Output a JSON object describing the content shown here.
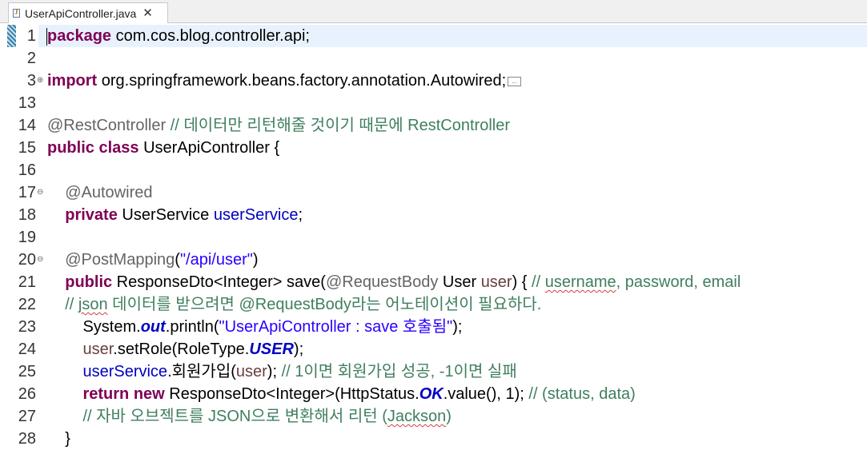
{
  "tab": {
    "label": "UserApiController.java",
    "close": "✕",
    "file_icon": "J"
  },
  "lines": [
    {
      "num": "1",
      "tokens": [
        {
          "t": "kw",
          "v": "package"
        },
        {
          "t": "plain",
          "v": " com.cos.blog.controller.api;"
        }
      ]
    },
    {
      "num": "2",
      "tokens": []
    },
    {
      "num": "3",
      "fold": "⊕",
      "tokens": [
        {
          "t": "kw",
          "v": "import"
        },
        {
          "t": "plain",
          "v": " org.springframework.beans.factory.annotation.Autowired;"
        }
      ],
      "collapsed": "..."
    },
    {
      "num": "13",
      "tokens": []
    },
    {
      "num": "14",
      "tokens": [
        {
          "t": "ann",
          "v": "@RestController"
        },
        {
          "t": "plain",
          "v": " "
        },
        {
          "t": "cmt",
          "v": "// 데이터만 리턴해줄 것이기 때문에 RestController"
        }
      ]
    },
    {
      "num": "15",
      "tokens": [
        {
          "t": "kw",
          "v": "public"
        },
        {
          "t": "plain",
          "v": " "
        },
        {
          "t": "kw",
          "v": "class"
        },
        {
          "t": "plain",
          "v": " UserApiController {"
        }
      ]
    },
    {
      "num": "16",
      "tokens": []
    },
    {
      "num": "17",
      "fold": "⊖",
      "tokens": [
        {
          "t": "plain",
          "v": "    "
        },
        {
          "t": "ann",
          "v": "@Autowired"
        }
      ]
    },
    {
      "num": "18",
      "tokens": [
        {
          "t": "plain",
          "v": "    "
        },
        {
          "t": "kw",
          "v": "private"
        },
        {
          "t": "plain",
          "v": " UserService "
        },
        {
          "t": "fld",
          "v": "userService"
        },
        {
          "t": "plain",
          "v": ";"
        }
      ]
    },
    {
      "num": "19",
      "tokens": []
    },
    {
      "num": "20",
      "fold": "⊖",
      "tokens": [
        {
          "t": "plain",
          "v": "    "
        },
        {
          "t": "ann",
          "v": "@PostMapping"
        },
        {
          "t": "plain",
          "v": "("
        },
        {
          "t": "str",
          "v": "\"/api/user\""
        },
        {
          "t": "plain",
          "v": ")"
        }
      ]
    },
    {
      "num": "21",
      "tokens": [
        {
          "t": "plain",
          "v": "    "
        },
        {
          "t": "kw",
          "v": "public"
        },
        {
          "t": "plain",
          "v": " ResponseDto<Integer> save("
        },
        {
          "t": "ann",
          "v": "@RequestBody"
        },
        {
          "t": "plain",
          "v": " User "
        },
        {
          "t": "var",
          "v": "user"
        },
        {
          "t": "plain",
          "v": ") { "
        },
        {
          "t": "cmt",
          "v": "// "
        },
        {
          "t": "cmt-squig",
          "v": "username"
        },
        {
          "t": "cmt",
          "v": ", password, email"
        }
      ]
    },
    {
      "num": "22",
      "tokens": [
        {
          "t": "plain",
          "v": "    "
        },
        {
          "t": "cmt",
          "v": "// "
        },
        {
          "t": "cmt-squig",
          "v": "json"
        },
        {
          "t": "cmt",
          "v": " 데이터를 받으려면 @RequestBody라는 어노테이션이 필요하다."
        }
      ]
    },
    {
      "num": "23",
      "tokens": [
        {
          "t": "plain",
          "v": "        System."
        },
        {
          "t": "sfld",
          "v": "out"
        },
        {
          "t": "plain",
          "v": ".println("
        },
        {
          "t": "str",
          "v": "\"UserApiController : save 호출됨\""
        },
        {
          "t": "plain",
          "v": ");"
        }
      ]
    },
    {
      "num": "24",
      "tokens": [
        {
          "t": "plain",
          "v": "        "
        },
        {
          "t": "var",
          "v": "user"
        },
        {
          "t": "plain",
          "v": ".setRole(RoleType."
        },
        {
          "t": "sfld",
          "v": "USER"
        },
        {
          "t": "plain",
          "v": ");"
        }
      ]
    },
    {
      "num": "25",
      "tokens": [
        {
          "t": "plain",
          "v": "        "
        },
        {
          "t": "fld",
          "v": "userService"
        },
        {
          "t": "plain",
          "v": ".회원가입("
        },
        {
          "t": "var",
          "v": "user"
        },
        {
          "t": "plain",
          "v": "); "
        },
        {
          "t": "cmt",
          "v": "// 1이면 회원가입 성공, -1이면 실패"
        }
      ]
    },
    {
      "num": "26",
      "tokens": [
        {
          "t": "plain",
          "v": "        "
        },
        {
          "t": "kw",
          "v": "return"
        },
        {
          "t": "plain",
          "v": " "
        },
        {
          "t": "kw",
          "v": "new"
        },
        {
          "t": "plain",
          "v": " ResponseDto<Integer>(HttpStatus."
        },
        {
          "t": "sfld",
          "v": "OK"
        },
        {
          "t": "plain",
          "v": ".value(), 1); "
        },
        {
          "t": "cmt",
          "v": "// (status, data)"
        }
      ]
    },
    {
      "num": "27",
      "tokens": [
        {
          "t": "plain",
          "v": "        "
        },
        {
          "t": "cmt",
          "v": "// 자바 오브젝트를 JSON으로 변환해서 리턴 ("
        },
        {
          "t": "cmt-squig",
          "v": "Jackson"
        },
        {
          "t": "cmt",
          "v": ")"
        }
      ]
    },
    {
      "num": "28",
      "tokens": [
        {
          "t": "plain",
          "v": "    }"
        }
      ]
    }
  ]
}
